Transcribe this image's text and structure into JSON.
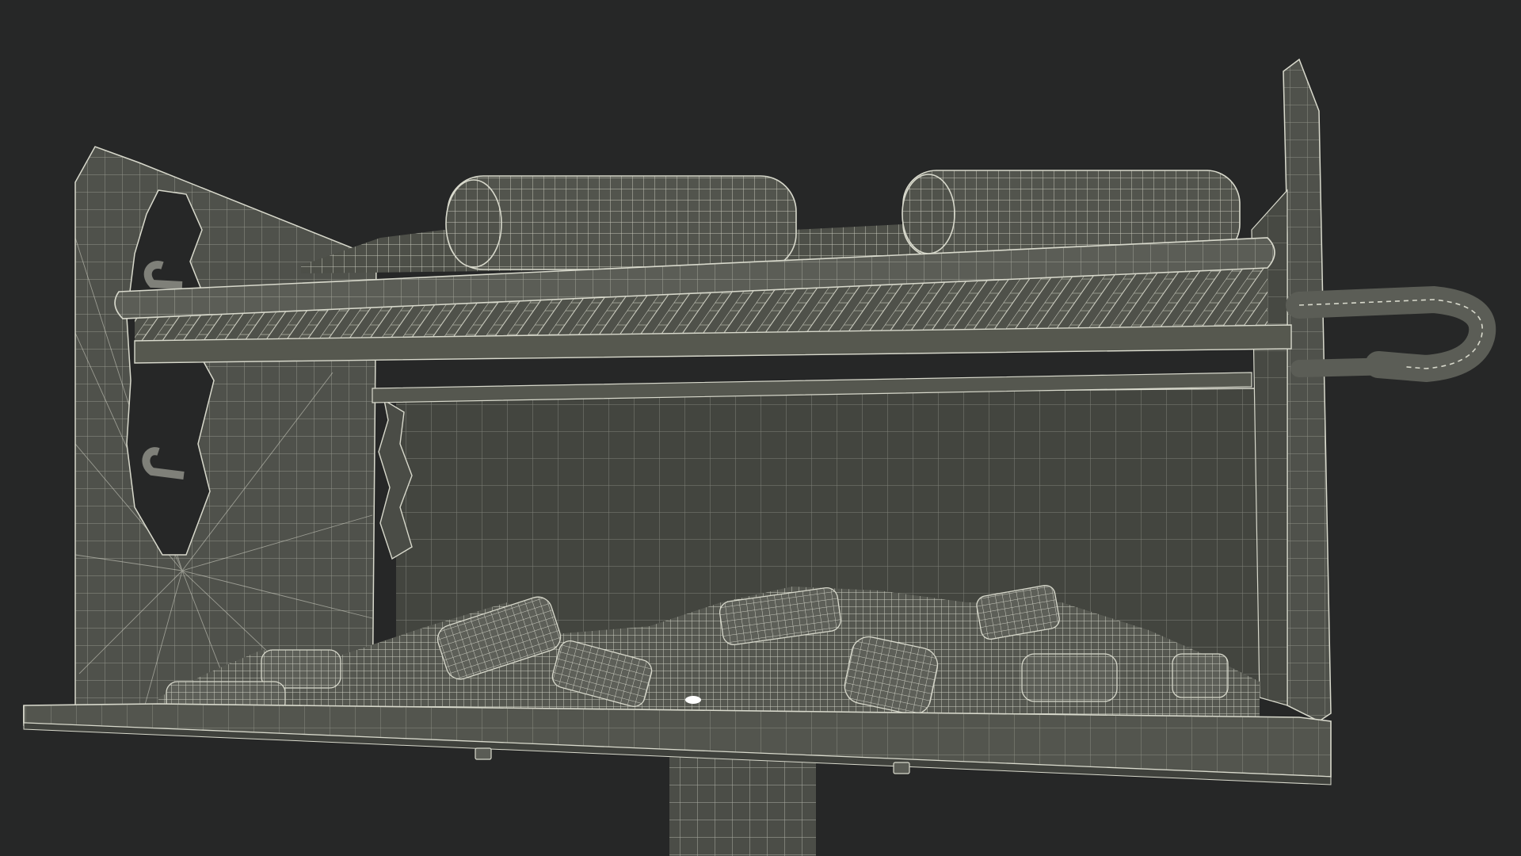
{
  "scene": {
    "subject": "grill-wireframe-render",
    "colors": {
      "background": "#262727",
      "surface": "#4d4f49",
      "surface_light": "#5b5d56",
      "surface_dark": "#3a3c37",
      "interior": "#42443f",
      "wire": "#d8d9cc",
      "highlight": "#ffffff"
    }
  }
}
